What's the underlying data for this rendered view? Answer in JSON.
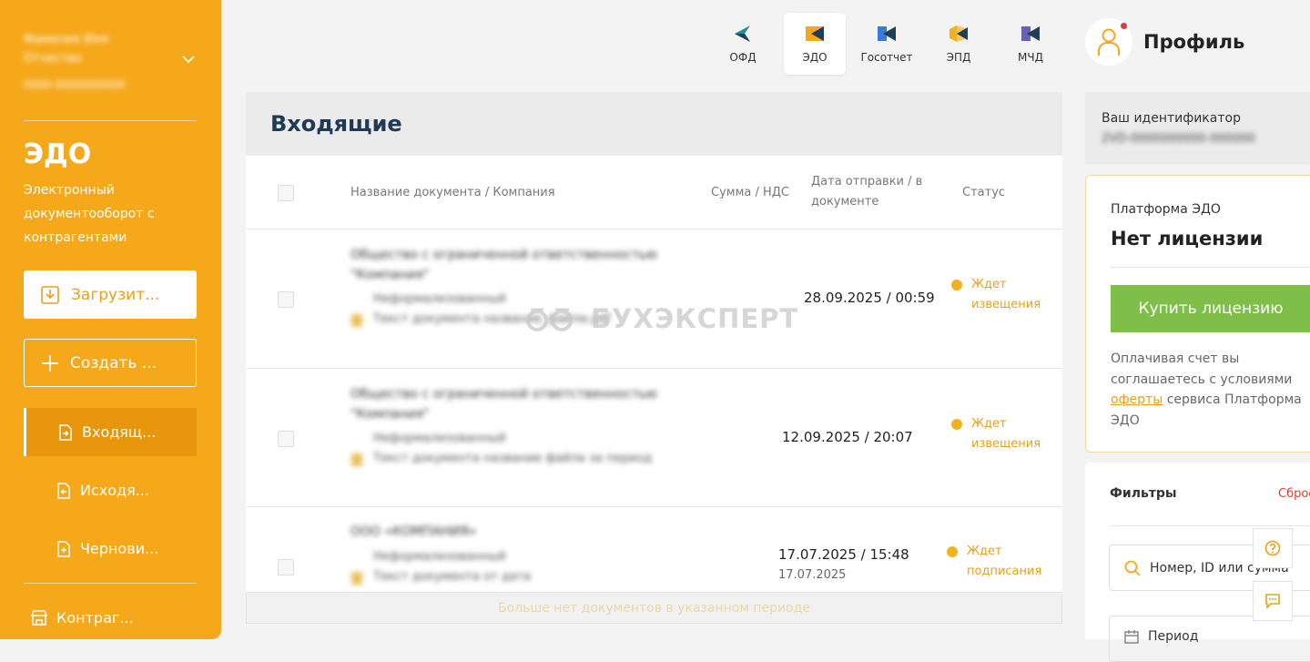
{
  "sidebar": {
    "user_name_line1": "Фамилия Имя",
    "user_name_line2": "Отчество",
    "user_id": "0000-0000000000",
    "section_title": "ЭДО",
    "section_subtitle": "Электронный документооборот с контрагентами",
    "upload_label": "Загрузит...",
    "create_label": "Создать ...",
    "nav": [
      {
        "label": "Входящ..."
      },
      {
        "label": "Исходя..."
      },
      {
        "label": "Чернови..."
      },
      {
        "label": "Контраг..."
      }
    ]
  },
  "top_tabs": [
    {
      "label": "ОФД",
      "icon": "ofd-icon",
      "color": "#2a8c9b"
    },
    {
      "label": "ЭДО",
      "icon": "edo-icon",
      "color": "#f6a81b"
    },
    {
      "label": "Госотчет",
      "icon": "gosotchet-icon",
      "color": "#3a7bd5"
    },
    {
      "label": "ЭПД",
      "icon": "epd-icon",
      "color": "#f2b21e"
    },
    {
      "label": "МЧД",
      "icon": "mchd-icon",
      "color": "#6b5fb5"
    }
  ],
  "profile": {
    "label": "Профиль"
  },
  "main": {
    "title": "Входящие",
    "columns": {
      "name": "Название документа / Компания",
      "sum": "Сумма / НДС",
      "date": "Дата отправки / в документе",
      "status": "Статус"
    },
    "rows": [
      {
        "company": "Общество с ограниченной ответственностью \"Компания\"",
        "sender": "Неформализованный",
        "doc": "Текст документа название_файла.pdf",
        "date_sent": "28.09.2025 / 00:59",
        "date_doc": "",
        "status": "Ждет извещения"
      },
      {
        "company": "Общество с ограниченной ответственностью \"Компания\"",
        "sender": "Неформализованный",
        "doc": "Текст документа название файла за период",
        "date_sent": "12.09.2025 / 20:07",
        "date_doc": "",
        "status": "Ждет извещения"
      },
      {
        "company": "ООО «КОМПАНИЯ»",
        "sender": "Неформализованный",
        "doc": "Текст документа от дата",
        "date_sent": "17.07.2025 / 15:48",
        "date_doc": "17.07.2025",
        "status": "Ждет подписания"
      }
    ],
    "footer_note": "Больше нет документов в указанном периоде"
  },
  "watermark": "БУХЭКСПЕРТ",
  "identifier": {
    "label": "Ваш идентификатор",
    "value": "2VD-0000000000-000000"
  },
  "license": {
    "platform": "Платформа ЭДО",
    "status": "Нет лицензии",
    "buy_label": "Купить лицензию",
    "offer_prefix": "Оплачивая счет вы соглашаетесь с условиями ",
    "offer_link": "оферты",
    "offer_suffix": " сервиса Платформа ЭДО"
  },
  "filters": {
    "title": "Фильтры",
    "reset": "Сброс",
    "search_placeholder": "Номер, ID или сумма",
    "period_placeholder": "Период"
  },
  "colors": {
    "accent": "#f6a81b",
    "buy": "#7fbf49",
    "status": "#e8a01a"
  }
}
